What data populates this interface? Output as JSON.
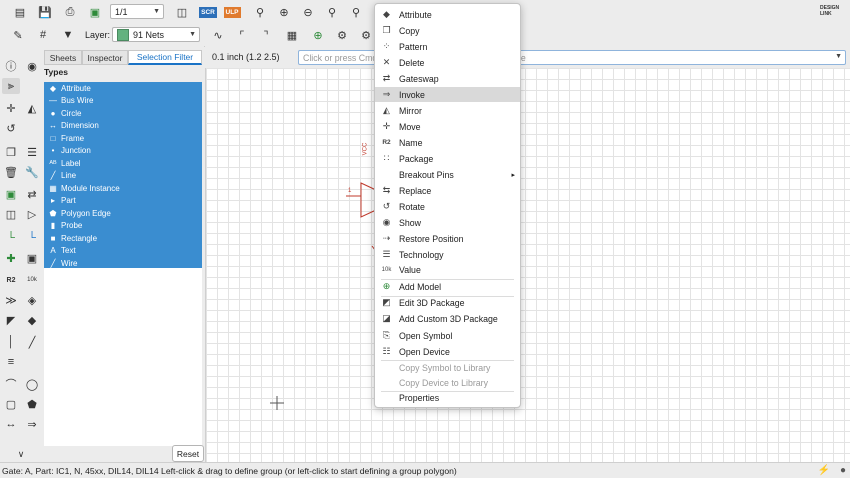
{
  "toolbar": {
    "page_value": "1/1",
    "scr_label": "SCR",
    "ulp_label": "ULP",
    "design_link_label": "DESIGN LINK",
    "layer_label": "Layer:",
    "layer_value": "91 Nets",
    "layer_color": "#63b27f"
  },
  "panel": {
    "tabs": [
      "Sheets",
      "Inspector",
      "Selection Filter"
    ],
    "types_label": "Types",
    "types": [
      {
        "label": "Attribute",
        "icon": "◆"
      },
      {
        "label": "Bus Wire",
        "icon": "—"
      },
      {
        "label": "Circle",
        "icon": "●"
      },
      {
        "label": "Dimension",
        "icon": "↔"
      },
      {
        "label": "Frame",
        "icon": "□"
      },
      {
        "label": "Junction",
        "icon": "•"
      },
      {
        "label": "Label",
        "icon": "AB"
      },
      {
        "label": "Line",
        "icon": "╱"
      },
      {
        "label": "Module Instance",
        "icon": "▦"
      },
      {
        "label": "Part",
        "icon": "▸"
      },
      {
        "label": "Polygon Edge",
        "icon": "⬟"
      },
      {
        "label": "Probe",
        "icon": "▮"
      },
      {
        "label": "Rectangle",
        "icon": "■"
      },
      {
        "label": "Text",
        "icon": "A"
      },
      {
        "label": "Wire",
        "icon": "╱"
      }
    ],
    "reset_label": "Reset"
  },
  "canvas": {
    "grid_label": "0.1 inch (1.2 2.5)",
    "command_placeholder": "Click or press Cmd",
    "command_suffix": "de",
    "vcc_label": "VCC",
    "pin_label": "1"
  },
  "menu": {
    "items": [
      {
        "label": "Attribute",
        "icon": "◆"
      },
      {
        "label": "Copy",
        "icon": "❐"
      },
      {
        "label": "Pattern",
        "icon": "⁘"
      },
      {
        "label": "Delete",
        "icon": "✕"
      },
      {
        "label": "Gateswap",
        "icon": "⇄"
      },
      {
        "label": "Invoke",
        "icon": "⇒"
      },
      {
        "label": "Mirror",
        "icon": "◭"
      },
      {
        "label": "Move",
        "icon": "✛"
      },
      {
        "label": "Name",
        "icon": "R2"
      },
      {
        "label": "Package",
        "icon": "∷"
      },
      {
        "label": "Breakout Pins",
        "icon": ""
      },
      {
        "label": "Replace",
        "icon": "⇆"
      },
      {
        "label": "Rotate",
        "icon": "↺"
      },
      {
        "label": "Show",
        "icon": "◉"
      },
      {
        "label": "Restore Position",
        "icon": "⇢"
      },
      {
        "label": "Technology",
        "icon": "☰"
      },
      {
        "label": "Value",
        "icon": "10k"
      },
      {
        "label": "Add Model",
        "icon": "⊕"
      },
      {
        "label": "Edit 3D Package",
        "icon": "◩"
      },
      {
        "label": "Add Custom 3D Package",
        "icon": "◪"
      },
      {
        "label": "Open Symbol",
        "icon": "⎘"
      },
      {
        "label": "Open Device",
        "icon": "☷"
      },
      {
        "label": "Copy Symbol to Library",
        "icon": ""
      },
      {
        "label": "Copy Device to Library",
        "icon": ""
      },
      {
        "label": "Properties",
        "icon": ""
      }
    ],
    "submenu_arrow": "▸"
  },
  "status": {
    "text": "Gate: A, Part: IC1, N, 45xx, DIL14, DIL14 Left-click & drag to define group (or left-click to start defining a group polygon)"
  },
  "colors": {
    "accent": "#1a73c6",
    "selection_blue": "#3a8dd0",
    "schematic_red": "#c0392b"
  }
}
